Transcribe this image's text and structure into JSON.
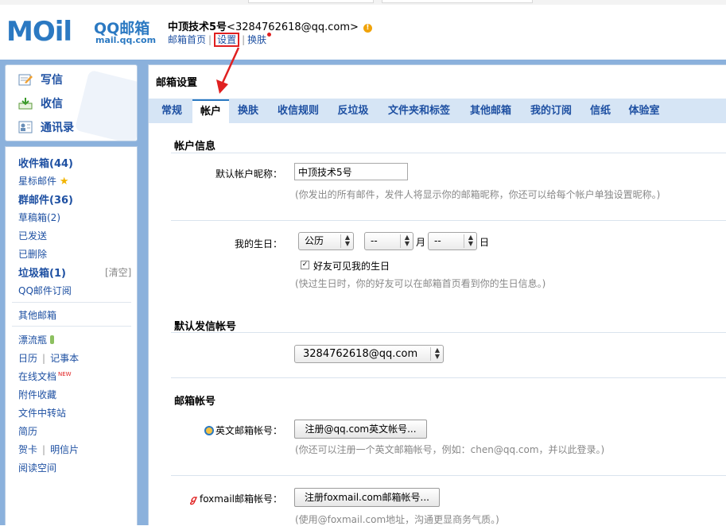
{
  "logo": {
    "brand_mark": "MOil",
    "name": "QQ邮箱",
    "domain": "mail.qq.com"
  },
  "user": {
    "nickname": "中顶技术5号",
    "email": "<3284762618@qq.com>",
    "warn_mark": "!"
  },
  "top_links": {
    "home": "邮箱首页",
    "separator": "|",
    "settings": "设置",
    "skin": "换肤"
  },
  "quick_actions": {
    "compose": "写信",
    "receive": "收信",
    "contacts": "通讯录"
  },
  "folders": {
    "inbox": "收件箱(44)",
    "starred": "星标邮件",
    "group": "群邮件(36)",
    "drafts": "草稿箱(2)",
    "sent": "已发送",
    "deleted": "已删除",
    "spam": "垃圾箱(1)",
    "spam_clear": "[清空]",
    "subscriptions": "QQ邮件订阅",
    "other_mailbox": "其他邮箱",
    "drift_bottle": "漂流瓶",
    "calendar": "日历",
    "notepad": "记事本",
    "separator": "|",
    "online_docs": "在线文档",
    "new_badge": "NEW",
    "attachments": "附件收藏",
    "file_transfer": "文件中转站",
    "resume": "简历",
    "greeting_card": "贺卡",
    "postcard": "明信片",
    "reading_space": "阅读空间"
  },
  "main": {
    "title": "邮箱设置",
    "tabs": [
      "常规",
      "帐户",
      "换肤",
      "收信规则",
      "反垃圾",
      "文件夹和标签",
      "其他邮箱",
      "我的订阅",
      "信纸",
      "体验室"
    ],
    "active_tab": "帐户"
  },
  "account_info": {
    "section_title": "帐户信息",
    "nickname_label": "默认帐户昵称：",
    "nickname_value": "中顶技术5号",
    "nickname_hint": "(你发出的所有邮件，发件人将显示你的邮箱昵称，你还可以给每个帐户单独设置昵称。)",
    "birthday_label": "我的生日：",
    "calendar_type": "公历",
    "month_value": "--",
    "month_unit": "月",
    "day_value": "--",
    "day_unit": "日",
    "visible_checkbox_label": "好友可见我的生日",
    "visible_checked": true,
    "birthday_hint": "(快过生日时，你的好友可以在邮箱首页看到你的生日信息。)"
  },
  "default_sender": {
    "section_title": "默认发信帐号",
    "selected": "3284762618@qq.com"
  },
  "mail_accounts": {
    "section_title": "邮箱帐号",
    "english_label": "英文邮箱帐号：",
    "english_button": "注册@qq.com英文帐号...",
    "english_hint": "(你还可以注册一个英文邮箱帐号，例如：chen@qq.com，并以此登录。)",
    "foxmail_label": "foxmail邮箱帐号：",
    "foxmail_button": "注册foxmail.com邮箱帐号...",
    "foxmail_hint": "(使用@foxmail.com地址，沟通更显商务气质。)"
  },
  "colors": {
    "accent_blue": "#2b79c2",
    "link_blue": "#1e50a2",
    "body_blue": "#8bb1dc",
    "tab_bar": "#d6e5f5",
    "annotation_red": "#e02020"
  }
}
